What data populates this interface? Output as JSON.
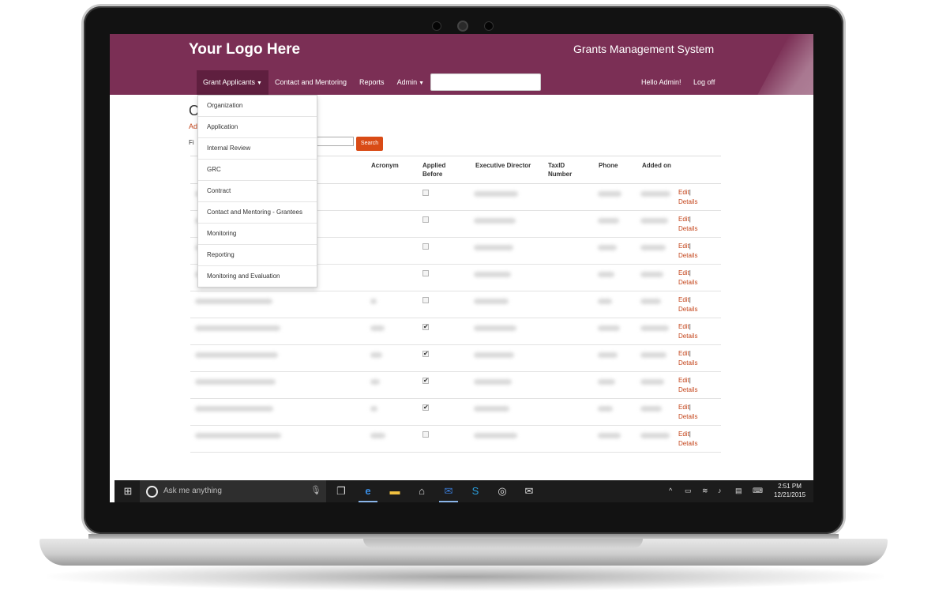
{
  "header": {
    "logo_text": "Your Logo Here",
    "app_title": "Grants Management System"
  },
  "nav": {
    "grant_applicants": "Grant Applicants",
    "contact_mentoring": "Contact and Mentoring",
    "reports": "Reports",
    "admin": "Admin",
    "search_placeholder": "",
    "hello": "Hello Admin!",
    "logoff": "Log off"
  },
  "dropdown": {
    "items": [
      "Organization",
      "Application",
      "Internal Review",
      "GRC",
      "Contract",
      "Contact and Mentoring - Grantees",
      "Monitoring",
      "Reporting",
      "Monitoring and Evaluation"
    ]
  },
  "page": {
    "heading": "O",
    "add_link": "Ad",
    "find_label": "Fi",
    "search_button": "Search"
  },
  "table": {
    "headers": {
      "acronym": "Acronym",
      "applied_before": "Applied Before",
      "executive_director": "Executive Director",
      "taxid": "TaxID Number",
      "phone": "Phone",
      "added_on": "Added on"
    },
    "edit_label": "Edit",
    "details_label": "Details",
    "separator": "|",
    "rows": [
      {
        "applied_before": false
      },
      {
        "applied_before": false
      },
      {
        "applied_before": false
      },
      {
        "applied_before": false
      },
      {
        "applied_before": false
      },
      {
        "applied_before": true
      },
      {
        "applied_before": true
      },
      {
        "applied_before": true
      },
      {
        "applied_before": true
      },
      {
        "applied_before": false
      }
    ]
  },
  "taskbar": {
    "search_text": "Ask me anything",
    "time": "2:51 PM",
    "date": "12/21/2015"
  },
  "colors": {
    "header": "#7b2f55",
    "accent": "#d94b16",
    "link": "#c4441a"
  }
}
